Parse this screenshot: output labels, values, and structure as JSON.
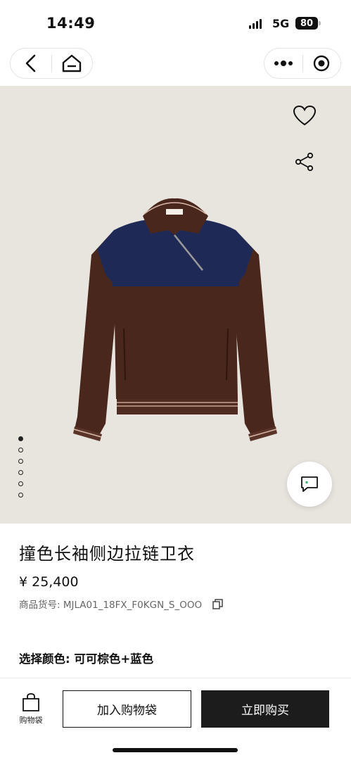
{
  "status_bar": {
    "time": "14:49",
    "network": "5G",
    "battery": "80",
    "icons": [
      "signal-icon",
      "battery-icon"
    ]
  },
  "navbar": {
    "icons": [
      "back-icon",
      "home-icon",
      "more-icon",
      "close-target-icon"
    ]
  },
  "gallery": {
    "image": "brown-navy-colorblock-zip-sweatshirt",
    "slide_count": 6,
    "active_slide": 1,
    "icons": [
      "heart-icon",
      "share-icon",
      "chat-icon"
    ]
  },
  "product": {
    "title": "撞色长袖侧边拉链卫衣",
    "price": "¥ 25,400",
    "sku": "商品货号: MJLA01_18FX_F0KGN_S_OOO",
    "color": "选择颜色: 可可棕色+蓝色"
  },
  "bottom_bar": {
    "bag_label": "购物袋",
    "add_to_bag": "加入购物袋",
    "buy_now": "立即购买"
  },
  "colors": {
    "hero_bg": "#e8e5df",
    "primary_dark": "#1c1c1c",
    "garment_brown": "#4a271d",
    "garment_navy": "#1e2a55"
  }
}
